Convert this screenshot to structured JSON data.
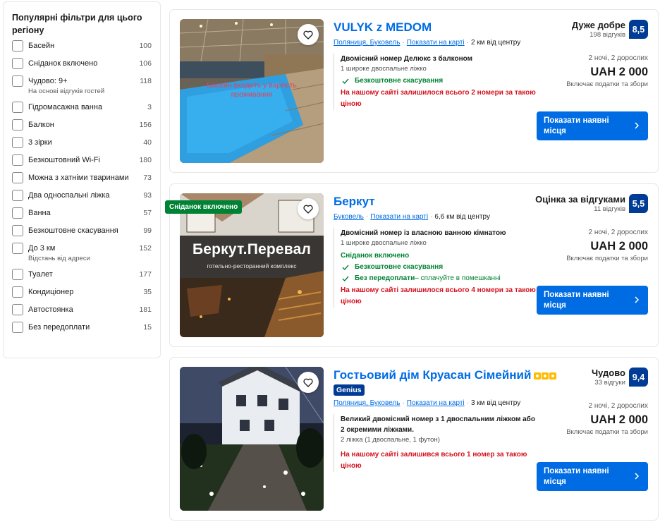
{
  "sidebar": {
    "title": "Популярні фільтри для цього регіону",
    "filters": [
      {
        "label": "Басейн",
        "count": "100",
        "sub": ""
      },
      {
        "label": "Сніданок включено",
        "count": "106",
        "sub": ""
      },
      {
        "label": "Чудово: 9+",
        "count": "118",
        "sub": "На основі відгуків гостей"
      },
      {
        "label": "Гідромасажна ванна",
        "count": "3",
        "sub": ""
      },
      {
        "label": "Балкон",
        "count": "156",
        "sub": ""
      },
      {
        "label": "3 зірки",
        "count": "40",
        "sub": ""
      },
      {
        "label": "Безкоштовний Wi-Fi",
        "count": "180",
        "sub": ""
      },
      {
        "label": "Можна з хатніми тваринами",
        "count": "73",
        "sub": ""
      },
      {
        "label": "Два односпальні ліжка",
        "count": "93",
        "sub": ""
      },
      {
        "label": "Ванна",
        "count": "57",
        "sub": ""
      },
      {
        "label": "Безкоштовне скасування",
        "count": "99",
        "sub": ""
      },
      {
        "label": "До 3 км",
        "count": "152",
        "sub": "Відстань від адреси"
      },
      {
        "label": "Туалет",
        "count": "177",
        "sub": ""
      },
      {
        "label": "Кондиціонер",
        "count": "35",
        "sub": ""
      },
      {
        "label": "Автостоянка",
        "count": "181",
        "sub": ""
      },
      {
        "label": "Без передоплати",
        "count": "15",
        "sub": ""
      }
    ]
  },
  "cards": [
    {
      "name": "VULYK z MEDOM",
      "photo_caption": "Басейн входить у вартість проживання",
      "location": "Поляниця, Буковель",
      "show_on_map": "Показати на карті",
      "distance": "2 км від центру",
      "room_title": "Двомісний номер Делюкс з балконом",
      "beds": "1 широке двоспальне ліжко",
      "free_cancel": "Безкоштовне скасування",
      "scarcity": "На нашому сайті залишилося всього 2 номери за такою ціною",
      "score_label": "Дуже добре",
      "reviews": "198 відгуків",
      "score": "8,5",
      "nights": "2 ночі, 2 дорослих",
      "price": "UAH 2 000",
      "taxes": "Включає податки та збори",
      "cta": "Показати наявні місця"
    },
    {
      "name": "Беркут",
      "badge": "Сніданок включено",
      "photo_title": "Беркут.Перевал",
      "photo_sub": "готельно-ресторанний комплекс",
      "location": "Буковель",
      "show_on_map": "Показати на карті",
      "distance": "6,6 км від центру",
      "room_title": "Двомісний номер із власною ванною кімнатою",
      "beds": "1 широке двоспальне ліжко",
      "breakfast": "Сніданок включено",
      "free_cancel": "Безкоштовне скасування",
      "no_prepay": "Без передоплати",
      "no_prepay_extra": " – сплачуйте в помешканні",
      "scarcity": "На нашому сайті залишилося всього 4 номери за такою ціною",
      "score_label": "Оцінка за відгуками",
      "reviews": "11 відгуків",
      "score": "5,5",
      "nights": "2 ночі, 2 дорослих",
      "price": "UAH 2 000",
      "taxes": "Включає податки та збори",
      "cta": "Показати наявні місця"
    },
    {
      "name": "Гостьовий дім Круасан Сімейний",
      "genius": "Genius",
      "location": "Поляниця, Буковель",
      "show_on_map": "Показати на карті",
      "distance": "3 км від центру",
      "room_title": "Великий двомісний номер з 1 двоспальним ліжком або 2 окремими ліжками.",
      "beds": "2 ліжка (1 двоспальне, 1 футон)",
      "scarcity": "На нашому сайті залишився всього 1 номер за такою ціною",
      "score_label": "Чудово",
      "reviews": "33 відгуки",
      "score": "9,4",
      "nights": "2 ночі, 2 дорослих",
      "price": "UAH 2 000",
      "taxes": "Включає податки та збори",
      "cta": "Показати наявні місця"
    }
  ],
  "icons": {
    "favorite": "heart-icon",
    "check": "check-icon",
    "cta_arrow": "chevron-right-icon",
    "stars": "star-rating-icons"
  },
  "colors": {
    "link": "#006ce4",
    "score_badge": "#003b95",
    "green": "#008234",
    "red": "#d4111e",
    "star": "#febb02"
  }
}
